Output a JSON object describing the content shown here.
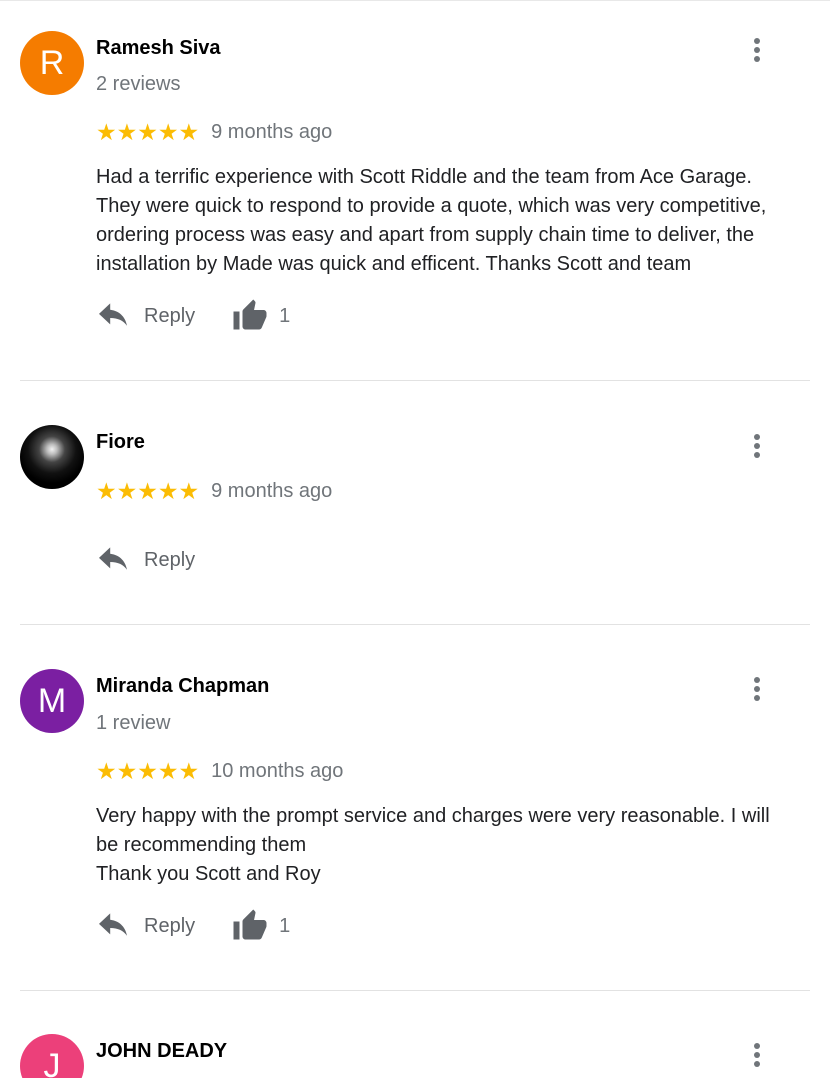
{
  "reviews": [
    {
      "author": "Ramesh Siva",
      "avatar_letter": "R",
      "avatar_color": "#f57c00",
      "review_count": "2 reviews",
      "stars": "★★★★★",
      "time_ago": "9 months ago",
      "text": "Had a terrific experience with Scott Riddle and the team from Ace Garage.\nThey were quick to respond to provide a quote, which was very competitive,\nordering process was easy and apart from supply chain time to deliver, the\ninstallation by Made was quick and efficent. Thanks Scott and team",
      "reply_label": "Reply",
      "like_count": "1"
    },
    {
      "author": "Fiore",
      "avatar_letter": "",
      "avatar_color": "#111111",
      "stars": "★★★★★",
      "time_ago": "9 months ago",
      "reply_label": "Reply"
    },
    {
      "author": "Miranda Chapman",
      "avatar_letter": "M",
      "avatar_color": "#7b1fa2",
      "review_count": "1 review",
      "stars": "★★★★★",
      "time_ago": "10 months ago",
      "text": "Very happy with the prompt service and charges were very reasonable. I will\nbe recommending them\nThank you Scott and Roy",
      "reply_label": "Reply",
      "like_count": "1"
    },
    {
      "author": "JOHN DEADY",
      "avatar_letter": "J",
      "avatar_color": "#ec407a"
    }
  ],
  "icons": {
    "menu": "more-vert-icon",
    "reply": "reply-icon",
    "like": "thumb-up-icon"
  },
  "colors": {
    "star": "#fbbc04",
    "secondary_text": "#70757a"
  }
}
